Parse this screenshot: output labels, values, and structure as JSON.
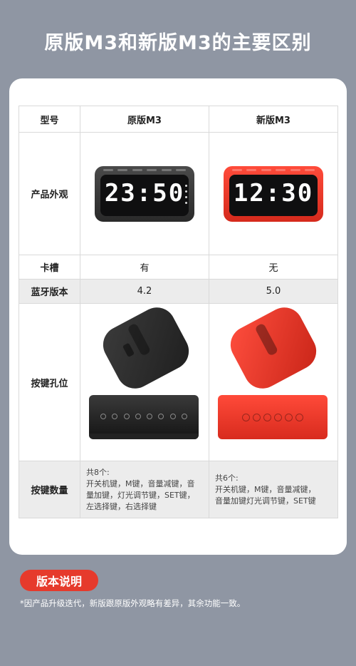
{
  "title": "原版M3和新版M3的主要区别",
  "table": {
    "headers": [
      "型号",
      "原版M3",
      "新版M3"
    ],
    "rows": {
      "appearance": {
        "label": "产品外观",
        "original_clock": "23:50",
        "new_clock": "12:30"
      },
      "card_slot": {
        "label": "卡槽",
        "original": "有",
        "new": "无"
      },
      "bluetooth": {
        "label": "蓝牙版本",
        "original": "4.2",
        "new": "5.0"
      },
      "button_holes": {
        "label": "按键孔位"
      },
      "button_count": {
        "label": "按键数量",
        "original_lines": [
          "共8个:",
          "开关机键，M键，音量减键，音",
          "量加键，灯光调节键，SET键，",
          "左选择键，右选择键"
        ],
        "new_lines": [
          "共6个:",
          "开关机键，M键，音量减键，",
          "音量加键灯光调节键，SET键"
        ]
      }
    }
  },
  "colors": {
    "background": "#8f96a3",
    "accent": "#e63a2c",
    "original_color": "#2a2a2a",
    "new_color": "#e83325"
  },
  "badge": "版本说明",
  "note": "*因产品升级迭代，新版跟原版外观略有差异，其余功能一致。"
}
